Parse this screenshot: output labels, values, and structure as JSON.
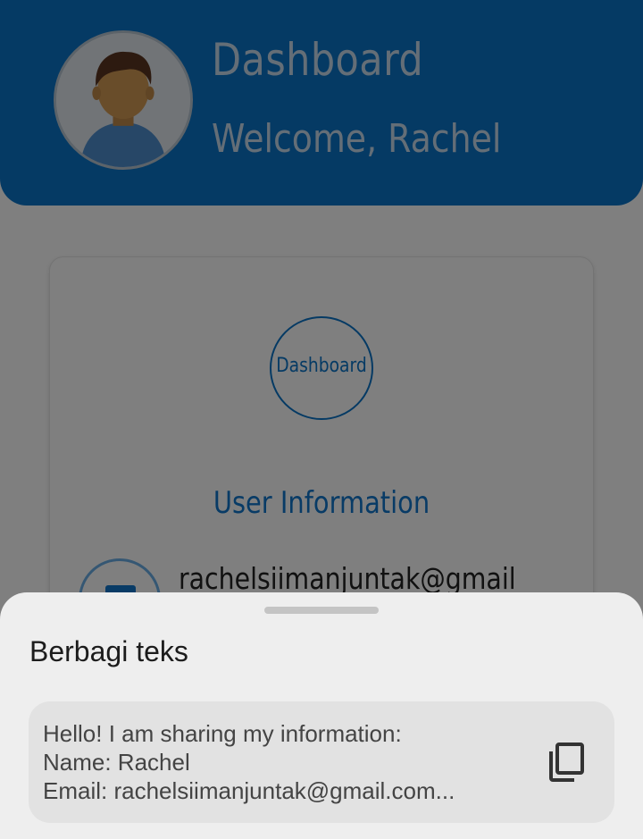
{
  "header": {
    "title": "Dashboard",
    "welcome": "Welcome, Rachel",
    "avatar_icon": "user-avatar-icon"
  },
  "card": {
    "logo_text": "Dashboard",
    "section_title": "User Information",
    "email_icon": "mail-icon",
    "email": "rachelsiimanjuntak@gmail"
  },
  "share_sheet": {
    "title": "Berbagi teks",
    "preview_lines": [
      "Hello! I am sharing my information:",
      "Name: Rachel",
      "Email: rachelsiimanjuntak@gmail.com..."
    ],
    "copy_icon": "copy-icon"
  },
  "colors": {
    "primary": "#0a74c8",
    "sheet_background": "#eeeeee",
    "preview_background": "#e2e2e2"
  }
}
